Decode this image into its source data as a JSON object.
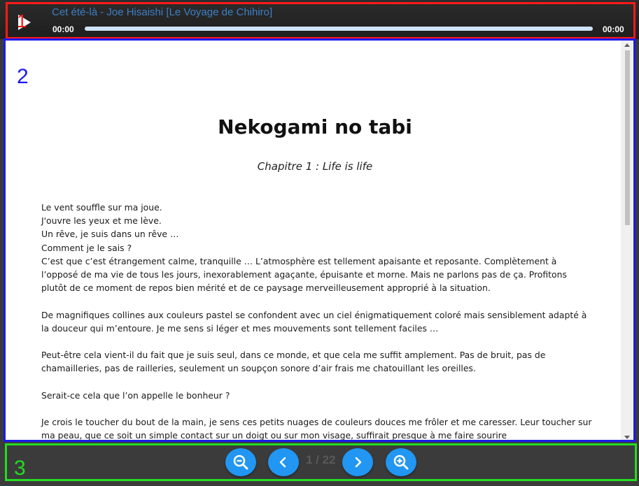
{
  "player": {
    "track_title": "Cet été-là - Joe Hisaishi [Le Voyage de Chihiro]",
    "time_current": "00:00",
    "time_total": "00:00",
    "progress": 0,
    "region_label": "1"
  },
  "reader": {
    "region_label": "2",
    "title": "Nekogami no tabi",
    "subtitle": "Chapitre 1 : Life is life",
    "paragraphs": [
      "Le vent souffle sur ma joue.\nJ'ouvre les yeux et me lève.\nUn rêve, je suis dans un rêve …\nComment je le sais ?\nC’est que c’est étrangement calme, tranquille … L’atmosphère est tellement apaisante et reposante. Complètement à l’opposé de ma vie de tous les jours, inexorablement agaçante, épuisante et morne. Mais ne parlons pas de ça. Profitons plutôt de ce moment de repos bien mérité et de ce paysage merveilleusement approprié à la situation.",
      "De magnifiques collines aux couleurs pastel se confondent avec un ciel énigmatiquement coloré mais sensiblement adapté à la douceur qui m’entoure. Je me sens si léger et mes mouvements sont tellement faciles …",
      "Peut-être cela vient-il du fait que je suis seul, dans ce monde, et que cela me suffit amplement. Pas de bruit, pas de chamailleries, pas de railleries, seulement un soupçon sonore d’air frais me chatouillant les oreilles.",
      "Serait-ce cela que l’on appelle le bonheur ?",
      "Je crois le toucher du bout de la main, je sens ces petits nuages de couleurs douces me frôler et me caresser. Leur toucher sur ma peau, que ce soit un simple contact sur un doigt ou sur mon visage, suffirait presque à me faire sourire"
    ]
  },
  "navbar": {
    "region_label": "3",
    "page_indicator": "1 / 22",
    "buttons": [
      "zoom-out-icon",
      "chevron-left-icon",
      "chevron-right-icon",
      "zoom-in-icon"
    ]
  },
  "colors": {
    "frame_1": "#ff1a1a",
    "frame_2": "#1a1aee",
    "frame_3": "#22dd22",
    "accent": "#2196f3",
    "track_title": "#3d7fc4"
  }
}
